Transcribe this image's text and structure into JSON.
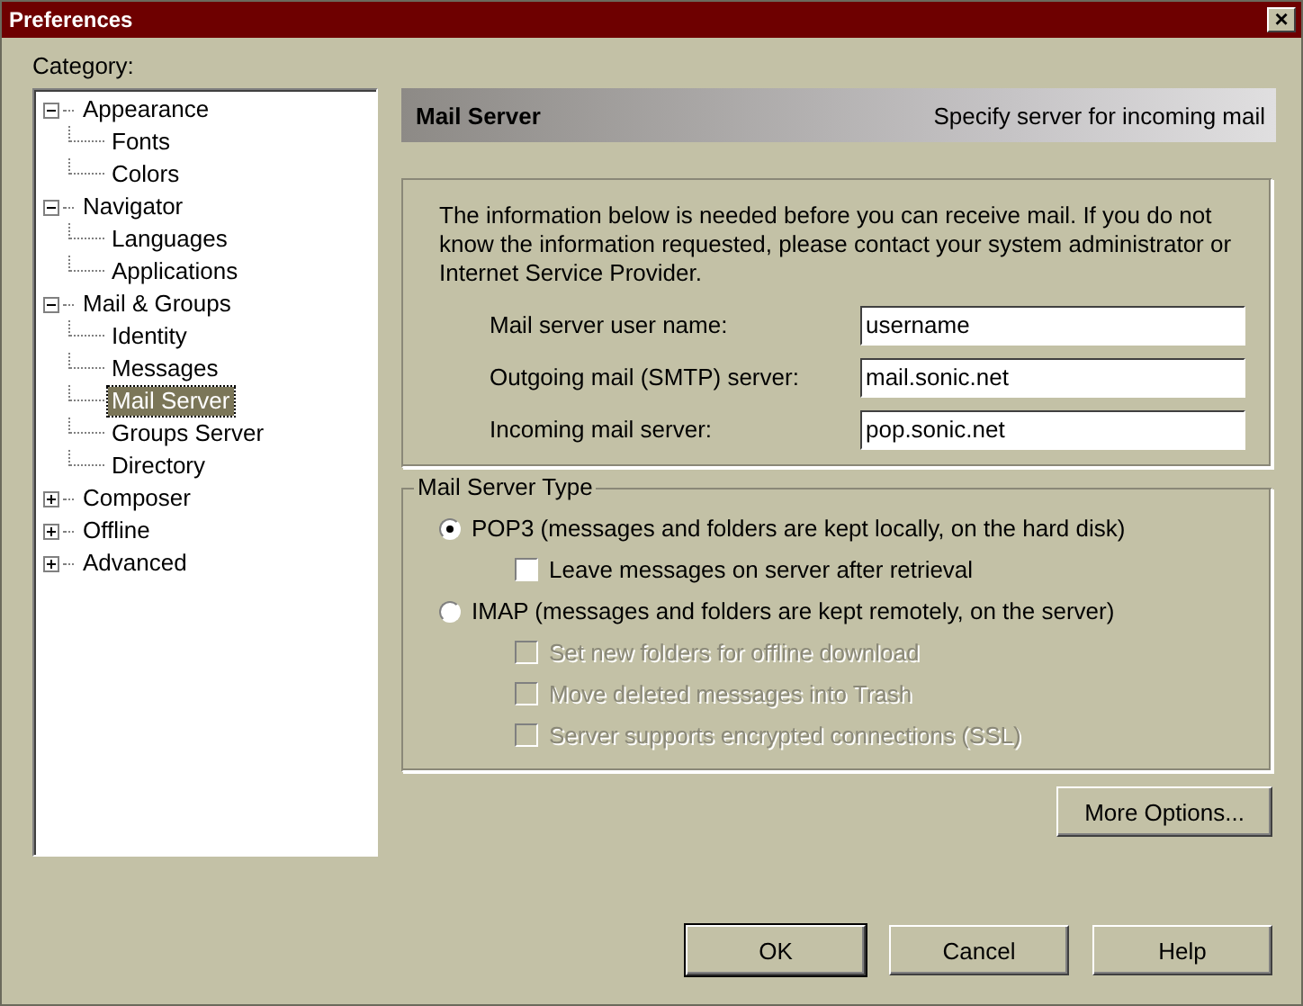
{
  "window": {
    "title": "Preferences",
    "close_label": "×"
  },
  "category_label": "Category:",
  "tree": [
    {
      "label": "Appearance",
      "expanded": true,
      "selected": false,
      "children": [
        {
          "label": "Fonts",
          "selected": false
        },
        {
          "label": "Colors",
          "selected": false
        }
      ]
    },
    {
      "label": "Navigator",
      "expanded": true,
      "selected": false,
      "children": [
        {
          "label": "Languages",
          "selected": false
        },
        {
          "label": "Applications",
          "selected": false
        }
      ]
    },
    {
      "label": "Mail & Groups",
      "expanded": true,
      "selected": false,
      "children": [
        {
          "label": "Identity",
          "selected": false
        },
        {
          "label": "Messages",
          "selected": false
        },
        {
          "label": "Mail Server",
          "selected": true
        },
        {
          "label": "Groups Server",
          "selected": false
        },
        {
          "label": "Directory",
          "selected": false
        }
      ]
    },
    {
      "label": "Composer",
      "expanded": false,
      "selected": false
    },
    {
      "label": "Offline",
      "expanded": false,
      "selected": false
    },
    {
      "label": "Advanced",
      "expanded": false,
      "selected": false
    }
  ],
  "header": {
    "title": "Mail Server",
    "subtitle": "Specify server for incoming mail"
  },
  "info": "The information below is needed before you can receive mail.  If you do not know the information requested, please contact your system administrator or Internet Service Provider.",
  "fields": [
    {
      "label": "Mail server user name:",
      "value": "username"
    },
    {
      "label": "Outgoing mail (SMTP) server:",
      "value": "mail.sonic.net"
    },
    {
      "label": "Incoming mail server:",
      "value": "pop.sonic.net"
    }
  ],
  "server_type": {
    "legend": "Mail Server Type",
    "options": [
      {
        "label": "POP3 (messages and folders are kept locally, on the hard disk)",
        "selected": true,
        "checkboxes": [
          {
            "label": "Leave messages on server after retrieval",
            "checked": false,
            "disabled": false
          }
        ]
      },
      {
        "label": "IMAP (messages and folders are kept remotely, on the server)",
        "selected": false,
        "checkboxes": [
          {
            "label": "Set new folders for offline download",
            "checked": false,
            "disabled": true
          },
          {
            "label": "Move deleted messages into Trash",
            "checked": false,
            "disabled": true
          },
          {
            "label": "Server supports encrypted connections (SSL)",
            "checked": false,
            "disabled": true
          }
        ]
      }
    ]
  },
  "more_options": "More Options...",
  "buttons": [
    {
      "label": "OK",
      "default": true
    },
    {
      "label": "Cancel",
      "default": false
    },
    {
      "label": "Help",
      "default": false
    }
  ]
}
